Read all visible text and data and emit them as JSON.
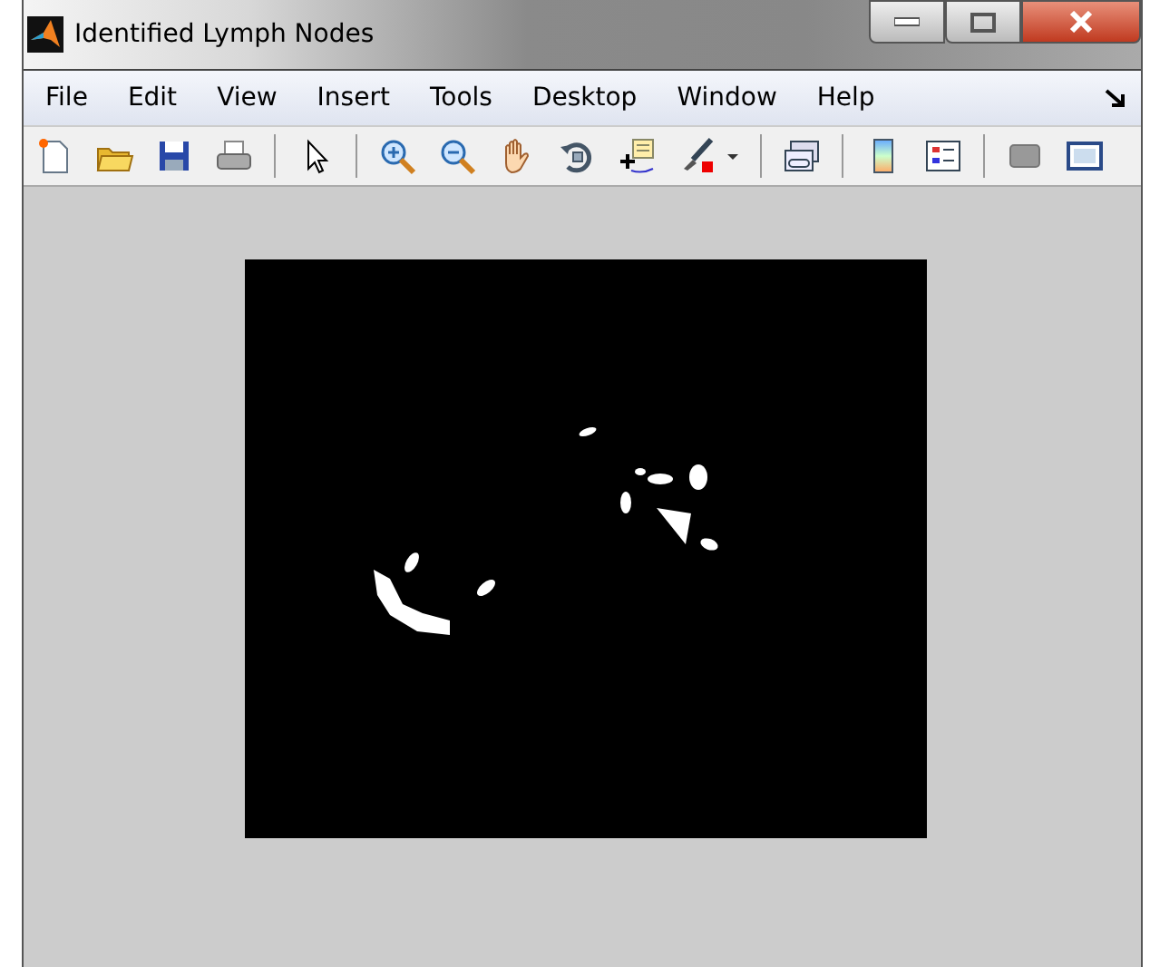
{
  "window": {
    "title": "Identified Lymph Nodes"
  },
  "menu": [
    "File",
    "Edit",
    "View",
    "Insert",
    "Tools",
    "Desktop",
    "Window",
    "Help"
  ]
}
